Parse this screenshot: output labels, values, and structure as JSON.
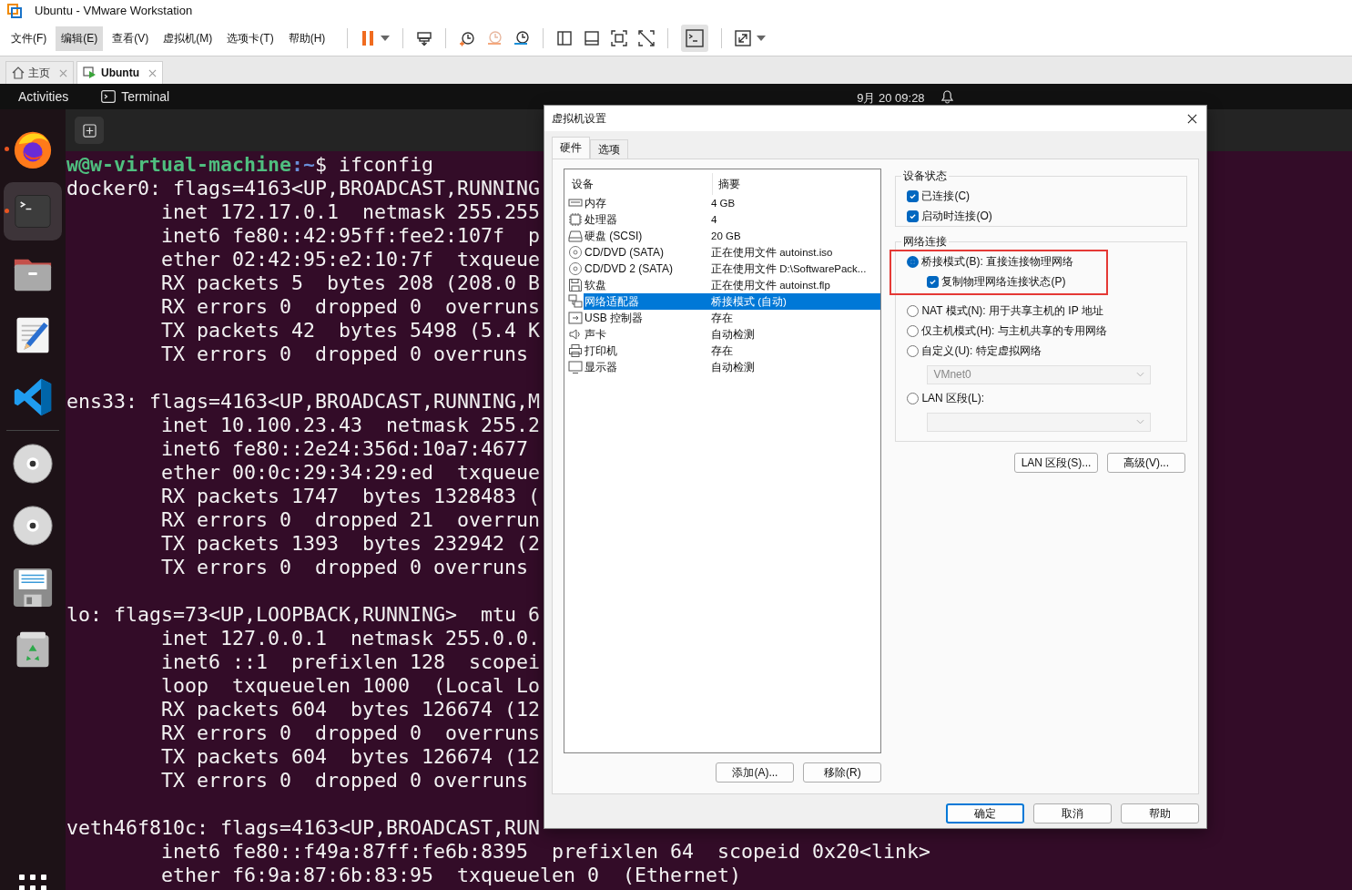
{
  "window": {
    "title": "Ubuntu - VMware Workstation"
  },
  "menu": [
    {
      "label": "文件(F)",
      "selected": false
    },
    {
      "label": "编辑(E)",
      "selected": true
    },
    {
      "label": "查看(V)",
      "selected": false
    },
    {
      "label": "虚拟机(M)",
      "selected": false
    },
    {
      "label": "选项卡(T)",
      "selected": false
    },
    {
      "label": "帮助(H)",
      "selected": false
    }
  ],
  "tabs": [
    {
      "kind": "home",
      "label": "主页",
      "selected": false
    },
    {
      "kind": "vm",
      "label": "Ubuntu",
      "selected": true
    }
  ],
  "guest_bar": {
    "activities": "Activities",
    "app": "Terminal",
    "clock": "9月 20  09:28"
  },
  "dock": [
    {
      "kind": "firefox",
      "running": true,
      "selected": false
    },
    {
      "kind": "terminal",
      "running": true,
      "selected": true
    },
    {
      "kind": "files",
      "running": false,
      "selected": false
    },
    {
      "kind": "editor",
      "running": false,
      "selected": false
    },
    {
      "kind": "vscode",
      "running": false,
      "selected": false
    },
    {
      "kind": "disc",
      "running": false,
      "selected": false
    },
    {
      "kind": "disc",
      "running": false,
      "selected": false
    },
    {
      "kind": "floppy",
      "running": false,
      "selected": false
    },
    {
      "kind": "trash",
      "running": false,
      "selected": false
    }
  ],
  "terminal": {
    "prompt_user": "w@w-virtual-machine",
    "prompt_path": ":~",
    "command": "$ ifconfig",
    "blocks": [
      {
        "header": "docker0: flags=4163<UP,BROADCAST,RUNNING",
        "details": [
          "inet 172.17.0.1  netmask 255.255",
          "inet6 fe80::42:95ff:fee2:107f  p",
          "ether 02:42:95:e2:10:7f  txqueue",
          "RX packets 5  bytes 208 (208.0 B",
          "RX errors 0  dropped 0  overruns",
          "TX packets 42  bytes 5498 (5.4 K",
          "TX errors 0  dropped 0 overruns"
        ]
      },
      {
        "header": "ens33: flags=4163<UP,BROADCAST,RUNNING,M",
        "details": [
          "inet 10.100.23.43  netmask 255.2",
          "inet6 fe80::2e24:356d:10a7:4677",
          "ether 00:0c:29:34:29:ed  txqueue",
          "RX packets 1747  bytes 1328483 (",
          "RX errors 0  dropped 21  overrun",
          "TX packets 1393  bytes 232942 (2",
          "TX errors 0  dropped 0 overruns"
        ]
      },
      {
        "header": "lo: flags=73<UP,LOOPBACK,RUNNING>  mtu 6",
        "details": [
          "inet 127.0.0.1  netmask 255.0.0.",
          "inet6 ::1  prefixlen 128  scopei",
          "loop  txqueuelen 1000  (Local Lo",
          "RX packets 604  bytes 126674 (12",
          "RX errors 0  dropped 0  overruns",
          "TX packets 604  bytes 126674 (12",
          "TX errors 0  dropped 0 overruns"
        ]
      },
      {
        "header": "veth46f810c: flags=4163<UP,BROADCAST,RUN",
        "details": [
          "inet6 fe80::f49a:87ff:fe6b:8395  prefixlen 64  scopeid 0x20<link>",
          "ether f6:9a:87:6b:83:95  txqueuelen 0  (Ethernet)"
        ]
      }
    ]
  },
  "dialog": {
    "title": "虚拟机设置",
    "tabs": [
      {
        "label": "硬件",
        "selected": true
      },
      {
        "label": "选项",
        "selected": false
      }
    ],
    "device_table": {
      "columns": [
        "设备",
        "摘要"
      ],
      "rows": [
        {
          "kind": "memory",
          "device": "内存",
          "summary": "4 GB",
          "selected": false
        },
        {
          "kind": "cpu",
          "device": "处理器",
          "summary": "4",
          "selected": false
        },
        {
          "kind": "disk",
          "device": "硬盘 (SCSI)",
          "summary": "20 GB",
          "selected": false
        },
        {
          "kind": "cd",
          "device": "CD/DVD (SATA)",
          "summary": "正在使用文件 autoinst.iso",
          "selected": false
        },
        {
          "kind": "cd",
          "device": "CD/DVD 2 (SATA)",
          "summary": "正在使用文件 D:\\SoftwarePack...",
          "selected": false
        },
        {
          "kind": "floppy",
          "device": "软盘",
          "summary": "正在使用文件 autoinst.flp",
          "selected": false
        },
        {
          "kind": "network",
          "device": "网络适配器",
          "summary": "桥接模式 (自动)",
          "selected": true
        },
        {
          "kind": "usb",
          "device": "USB 控制器",
          "summary": "存在",
          "selected": false
        },
        {
          "kind": "sound",
          "device": "声卡",
          "summary": "自动检测",
          "selected": false
        },
        {
          "kind": "printer",
          "device": "打印机",
          "summary": "存在",
          "selected": false
        },
        {
          "kind": "display",
          "device": "显示器",
          "summary": "自动检测",
          "selected": false
        }
      ]
    },
    "add_button": "添加(A)...",
    "remove_button": "移除(R)",
    "device_status": {
      "title": "设备状态",
      "options": [
        {
          "label": "已连接(C)",
          "checked": true
        },
        {
          "label": "启动时连接(O)",
          "checked": true
        }
      ]
    },
    "network": {
      "title": "网络连接",
      "highlighted_options": [
        {
          "kind": "radio",
          "label": "桥接模式(B): 直接连接物理网络",
          "selected": true
        },
        {
          "kind": "checkbox",
          "label": "复制物理网络连接状态(P)",
          "checked": true
        }
      ],
      "options": [
        {
          "kind": "radio",
          "label": "NAT 模式(N): 用于共享主机的 IP 地址",
          "selected": false
        },
        {
          "kind": "radio",
          "label": "仅主机模式(H): 与主机共享的专用网络",
          "selected": false
        },
        {
          "kind": "radio",
          "label": "自定义(U): 特定虚拟网络",
          "selected": false
        },
        {
          "kind": "dropdown",
          "value": "VMnet0",
          "disabled": true
        },
        {
          "kind": "radio",
          "label": "LAN 区段(L):",
          "selected": false
        },
        {
          "kind": "dropdown",
          "disabled": true
        }
      ]
    },
    "lan_button": "LAN 区段(S)...",
    "advanced_button": "高级(V)...",
    "buttons": [
      {
        "label": "确定",
        "default": true
      },
      {
        "label": "取消",
        "default": false
      },
      {
        "label": "帮助",
        "default": false
      }
    ]
  }
}
